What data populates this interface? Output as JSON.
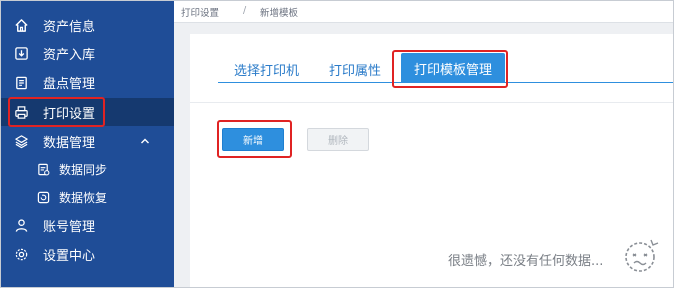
{
  "sidebar": {
    "items": [
      {
        "label": "资产信息",
        "icon": "home-icon"
      },
      {
        "label": "资产入库",
        "icon": "download-icon"
      },
      {
        "label": "盘点管理",
        "icon": "clipboard-icon"
      },
      {
        "label": "打印设置",
        "icon": "printer-icon",
        "active": true
      },
      {
        "label": "数据管理",
        "icon": "layers-icon",
        "expanded": true
      },
      {
        "label": "数据同步",
        "icon": "sync-doc-icon"
      },
      {
        "label": "数据恢复",
        "icon": "restore-icon"
      },
      {
        "label": "账号管理",
        "icon": "user-icon"
      },
      {
        "label": "设置中心",
        "icon": "gear-icon"
      }
    ]
  },
  "breadcrumb": {
    "parent": "打印设置",
    "separator": "/",
    "current": "新增模板"
  },
  "tabs": [
    {
      "label": "选择打印机"
    },
    {
      "label": "打印属性"
    },
    {
      "label": "打印模板管理",
      "active": true
    }
  ],
  "actions": {
    "add_label": "新增",
    "delete_label": "删除"
  },
  "empty_state": {
    "text": "很遗憾，还没有任何数据..."
  },
  "colors": {
    "sidebar_bg": "#1f4d97",
    "accent": "#2e8fde",
    "highlight": "#e02323"
  }
}
